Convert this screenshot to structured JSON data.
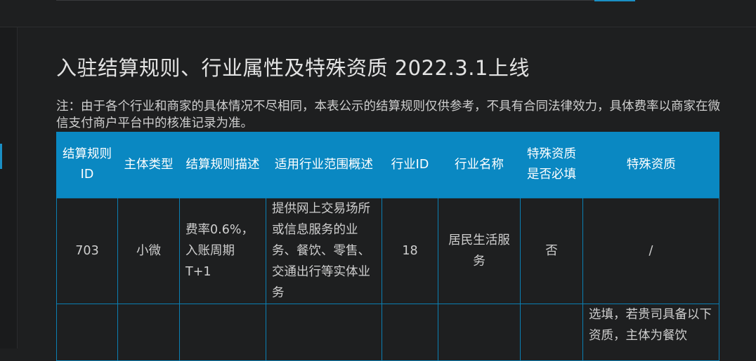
{
  "title": "入驻结算规则、行业属性及特殊资质 2022.3.1上线",
  "note": "注：由于各个行业和商家的具体情况不尽相同，本表公示的结算规则仅供参考，不具有合同法律效力，具体费率以商家在微信支付商户平台中的核准记录为准。",
  "table": {
    "headers": [
      "结算规则ID",
      "主体类型",
      "结算规则描述",
      "适用行业范围概述",
      "行业ID",
      "行业名称",
      "特殊资质是否必填",
      "特殊资质"
    ],
    "rows": [
      [
        "703",
        "小微",
        "费率0.6%，入账周期T+1",
        "提供网上交易场所或信息服务的业务、餐饮、零售、交通出行等实体业务",
        "18",
        "居民生活服务",
        "否",
        "/"
      ],
      [
        "",
        "",
        "",
        "",
        "",
        "",
        "",
        "选填，若贵司具备以下资质，主体为餐饮"
      ]
    ]
  }
}
